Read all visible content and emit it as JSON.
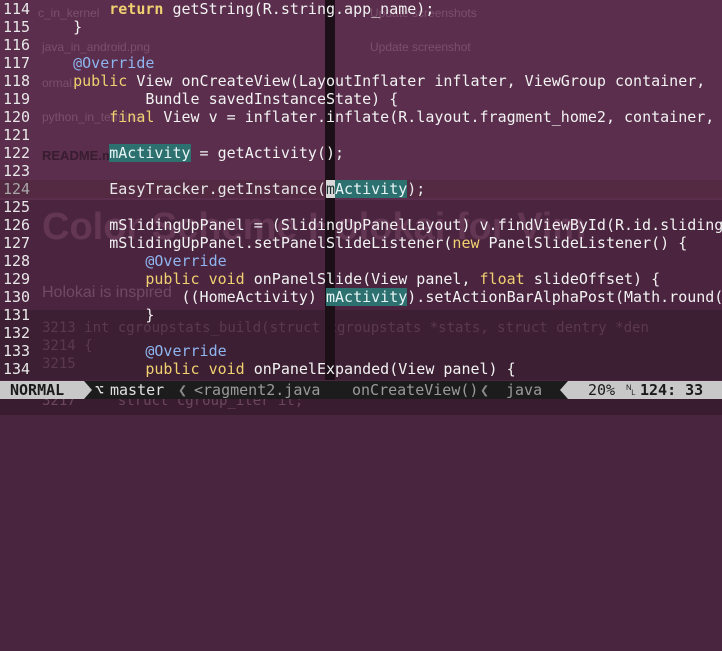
{
  "ghost": {
    "row1_left": "c_in_kernel",
    "row1_right": "Update screenshots",
    "row2_left": "java_in_android.png",
    "row2_right": "Update screenshot",
    "row3_left": "ormal...",
    "row4_left": "python_in_terminal",
    "readme": "README.md",
    "title": "Color Scheme Holokai for Vim",
    "subtitle": "Holokai is inspired",
    "code1": "3213 int cgroupstats_build(struct cgroupstats *stats, struct dentry *den",
    "code2": "3214 {",
    "code3": "3215",
    "code4": "3217     struct cgroup_iter it;"
  },
  "editor": {
    "lines": [
      {
        "num": "114",
        "parts": [
          {
            "t": "        "
          },
          {
            "t": "return",
            "c": "kwb"
          },
          {
            "t": " getString(R.string.app_name);"
          }
        ]
      },
      {
        "num": "115",
        "parts": [
          {
            "t": "    }"
          }
        ]
      },
      {
        "num": "116",
        "parts": [
          {
            "t": ""
          }
        ]
      },
      {
        "num": "117",
        "parts": [
          {
            "t": "    "
          },
          {
            "t": "@Override",
            "c": "an"
          }
        ]
      },
      {
        "num": "118",
        "parts": [
          {
            "t": "    "
          },
          {
            "t": "public",
            "c": "kw"
          },
          {
            "t": " View onCreateView(LayoutInflater inflater, ViewGroup container,"
          }
        ]
      },
      {
        "num": "119",
        "parts": [
          {
            "t": "            Bundle savedInstanceState) {"
          }
        ]
      },
      {
        "num": "120",
        "parts": [
          {
            "t": "        "
          },
          {
            "t": "final",
            "c": "kw"
          },
          {
            "t": " View v = inflater.inflate(R.layout.fragment_home2, container,"
          }
        ]
      },
      {
        "num": "121",
        "parts": [
          {
            "t": ""
          }
        ]
      },
      {
        "num": "122",
        "parts": [
          {
            "t": "        "
          },
          {
            "t": "mActivity",
            "c": "hl"
          },
          {
            "t": " = getActivity();"
          }
        ]
      },
      {
        "num": "123",
        "parts": [
          {
            "t": ""
          }
        ]
      },
      {
        "num": "124",
        "current": true,
        "parts": [
          {
            "t": "        EasyTracker.getInstance("
          },
          {
            "t": "m",
            "c": "cur"
          },
          {
            "t": "Activity",
            "c": "hl"
          },
          {
            "t": ");"
          }
        ]
      },
      {
        "num": "125",
        "parts": [
          {
            "t": ""
          }
        ]
      },
      {
        "num": "126",
        "parts": [
          {
            "t": "        mSlidingUpPanel = (SlidingUpPanelLayout) v.findViewById(R.id.sliding"
          }
        ]
      },
      {
        "num": "127",
        "parts": [
          {
            "t": "        mSlidingUpPanel.setPanelSlideListener("
          },
          {
            "t": "new",
            "c": "kw"
          },
          {
            "t": " PanelSlideListener() {"
          }
        ]
      },
      {
        "num": "128",
        "parts": [
          {
            "t": "            "
          },
          {
            "t": "@Override",
            "c": "an"
          }
        ]
      },
      {
        "num": "129",
        "parts": [
          {
            "t": "            "
          },
          {
            "t": "public",
            "c": "kw"
          },
          {
            "t": " "
          },
          {
            "t": "void",
            "c": "kw"
          },
          {
            "t": " onPanelSlide(View panel, "
          },
          {
            "t": "float",
            "c": "kw"
          },
          {
            "t": " slideOffset) {"
          }
        ]
      },
      {
        "num": "130",
        "parts": [
          {
            "t": "                ((HomeActivity) "
          },
          {
            "t": "mActivity",
            "c": "hl"
          },
          {
            "t": ").setActionBarAlphaPost(Math.round("
          }
        ]
      },
      {
        "num": "131",
        "parts": [
          {
            "t": "            }"
          }
        ]
      },
      {
        "num": "132",
        "parts": [
          {
            "t": ""
          }
        ]
      },
      {
        "num": "133",
        "parts": [
          {
            "t": "            "
          },
          {
            "t": "@Override",
            "c": "an"
          }
        ]
      },
      {
        "num": "134",
        "parts": [
          {
            "t": "            "
          },
          {
            "t": "public",
            "c": "kw"
          },
          {
            "t": " "
          },
          {
            "t": "void",
            "c": "kw"
          },
          {
            "t": " onPanelExpanded(View panel) {"
          }
        ]
      }
    ]
  },
  "statusbar": {
    "mode": "NORMAL",
    "branch_icon": "⌥",
    "branch": "master",
    "divider": "❮",
    "filename": "<ragment2.java",
    "function": "onCreateView()",
    "divider2": "❮",
    "filetype": "java",
    "percent": "20%",
    "ln_icon": "␤",
    "position": "124: 33"
  },
  "colors": {
    "background": "#4a2540",
    "keyword": "#f0d070",
    "annotation": "#8fb5f0",
    "search_highlight": "#2d7070",
    "statusbar_bg": "#1c1c1c",
    "mode_bg": "#c8c8c8"
  }
}
